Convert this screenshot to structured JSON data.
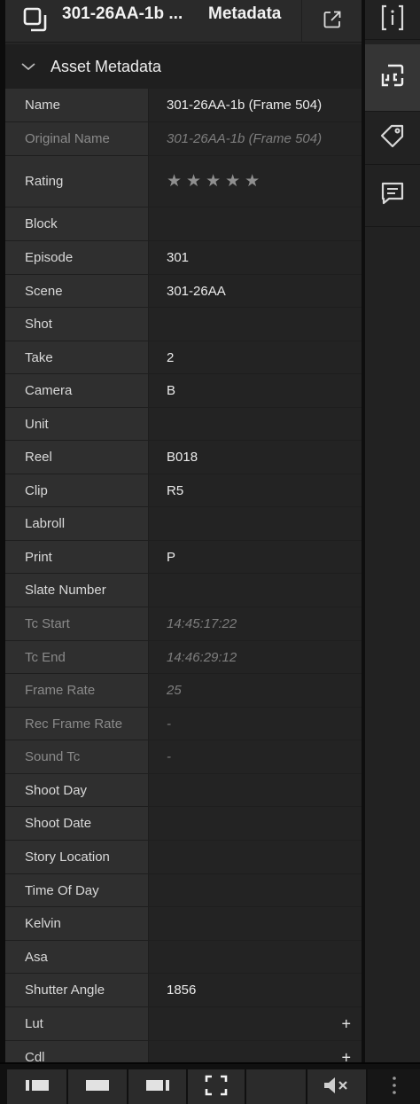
{
  "header": {
    "title": "301-26AA-1b ...",
    "subtitle": "Metadata",
    "asset_icon": "asset-icon",
    "popout_icon": "external-link-icon"
  },
  "section": {
    "label": "Asset Metadata",
    "icon": "chevron-down-icon"
  },
  "rows": [
    {
      "label": "Name",
      "value": "301-26AA-1b (Frame 504)",
      "dim": false
    },
    {
      "label": "Original Name",
      "value": "301-26AA-1b (Frame 504)",
      "dim": true
    },
    {
      "label": "Rating",
      "value": "★★★★★",
      "rating": 0,
      "max_rating": 5,
      "dim": false
    },
    {
      "label": "Block",
      "value": "",
      "dim": false
    },
    {
      "label": "Episode",
      "value": "301",
      "dim": false
    },
    {
      "label": "Scene",
      "value": "301-26AA",
      "dim": false
    },
    {
      "label": "Shot",
      "value": "",
      "dim": false
    },
    {
      "label": "Take",
      "value": "2",
      "dim": false
    },
    {
      "label": "Camera",
      "value": "B",
      "dim": false
    },
    {
      "label": "Unit",
      "value": "",
      "dim": false
    },
    {
      "label": "Reel",
      "value": "B018",
      "dim": false
    },
    {
      "label": "Clip",
      "value": "R5",
      "dim": false
    },
    {
      "label": "Labroll",
      "value": "",
      "dim": false
    },
    {
      "label": "Print",
      "value": "P",
      "dim": false
    },
    {
      "label": "Slate Number",
      "value": "",
      "dim": false
    },
    {
      "label": "Tc Start",
      "value": "14:45:17:22",
      "dim": true
    },
    {
      "label": "Tc End",
      "value": "14:46:29:12",
      "dim": true
    },
    {
      "label": "Frame Rate",
      "value": "25",
      "dim": true
    },
    {
      "label": "Rec Frame Rate",
      "value": "-",
      "dim": true
    },
    {
      "label": "Sound Tc",
      "value": "-",
      "dim": true
    },
    {
      "label": "Shoot Day",
      "value": "",
      "dim": false
    },
    {
      "label": "Shoot Date",
      "value": "",
      "dim": false
    },
    {
      "label": "Story Location",
      "value": "",
      "dim": false
    },
    {
      "label": "Time Of Day",
      "value": "",
      "dim": false
    },
    {
      "label": "Kelvin",
      "value": "",
      "dim": false
    },
    {
      "label": "Asa",
      "value": "",
      "dim": false
    },
    {
      "label": "Shutter Angle",
      "value": "1856",
      "dim": false
    },
    {
      "label": "Lut",
      "value": "",
      "action": "+",
      "dim": false
    },
    {
      "label": "Cdl",
      "value": "",
      "action": "+",
      "dim": false
    }
  ],
  "sidebar": {
    "items": [
      {
        "icon": "info-icon",
        "active": false
      },
      {
        "icon": "frame-icon",
        "active": true
      },
      {
        "icon": "tag-icon",
        "active": false
      },
      {
        "icon": "comment-icon",
        "active": false
      }
    ]
  },
  "bottom_bar": {
    "tools": [
      {
        "icon": "layout-left-icon"
      },
      {
        "icon": "layout-full-icon"
      },
      {
        "icon": "layout-right-icon"
      },
      {
        "icon": "fullscreen-icon"
      },
      {
        "icon": "blank-tool"
      },
      {
        "icon": "mute-icon"
      },
      {
        "icon": "more-icon"
      }
    ]
  },
  "colors": {
    "panel_bg": "#262626",
    "label_bg": "#2f2f2f",
    "value_bg": "#232323",
    "text": "#ececec",
    "dim_text": "#7e7e7e"
  }
}
